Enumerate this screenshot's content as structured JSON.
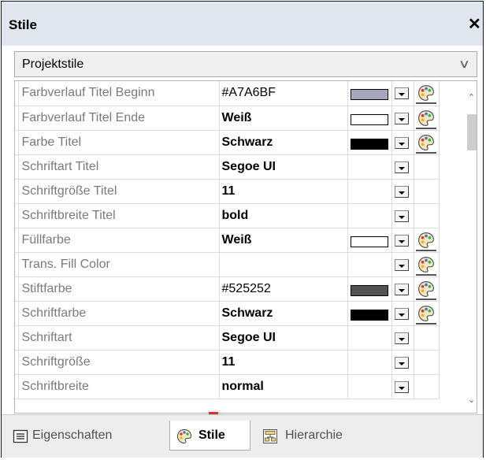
{
  "panel": {
    "title": "Stile",
    "close_glyph": "✕"
  },
  "selector": {
    "value": "Projektstile",
    "chevron": "﹀"
  },
  "properties": [
    {
      "name": "Farbverlauf Titel Beginn",
      "value": "#A7A6BF",
      "bold": false,
      "swatch": "#a7a6bf",
      "dropdown": true,
      "palette": true
    },
    {
      "name": "Farbverlauf Titel Ende",
      "value": "Weiß",
      "bold": true,
      "swatch": "#ffffff",
      "dropdown": true,
      "palette": true
    },
    {
      "name": "Farbe Titel",
      "value": "Schwarz",
      "bold": true,
      "swatch": "#000000",
      "dropdown": true,
      "palette": true
    },
    {
      "name": "Schriftart Titel",
      "value": "Segoe UI",
      "bold": true,
      "swatch": null,
      "dropdown": true,
      "palette": false
    },
    {
      "name": "Schriftgröße Titel",
      "value": "11",
      "bold": true,
      "swatch": null,
      "dropdown": true,
      "palette": false
    },
    {
      "name": "Schriftbreite Titel",
      "value": "bold",
      "bold": true,
      "swatch": null,
      "dropdown": true,
      "palette": false
    },
    {
      "name": "Füllfarbe",
      "value": "Weiß",
      "bold": true,
      "swatch": "#ffffff",
      "dropdown": true,
      "palette": true
    },
    {
      "name": "Trans. Fill Color",
      "value": "",
      "bold": false,
      "swatch": null,
      "dropdown": true,
      "palette": true
    },
    {
      "name": "Stiftfarbe",
      "value": "#525252",
      "bold": false,
      "swatch": "#525252",
      "dropdown": true,
      "palette": true
    },
    {
      "name": "Schriftfarbe",
      "value": "Schwarz",
      "bold": true,
      "swatch": "#000000",
      "dropdown": true,
      "palette": true
    },
    {
      "name": "Schriftart",
      "value": "Segoe UI",
      "bold": true,
      "swatch": null,
      "dropdown": true,
      "palette": false
    },
    {
      "name": "Schriftgröße",
      "value": "11",
      "bold": true,
      "swatch": null,
      "dropdown": true,
      "palette": false
    },
    {
      "name": "Schriftbreite",
      "value": "normal",
      "bold": true,
      "swatch": null,
      "dropdown": true,
      "palette": false
    }
  ],
  "scrollbar": {
    "up_glyph": "^",
    "down_glyph": "v"
  },
  "tabs": [
    {
      "id": "eigenschaften",
      "label": "Eigenschaften",
      "icon": "properties-list-icon",
      "active": false
    },
    {
      "id": "stile",
      "label": "Stile",
      "icon": "palette-icon",
      "active": true
    },
    {
      "id": "hierarchie",
      "label": "Hierarchie",
      "icon": "hierarchy-icon",
      "active": false
    }
  ],
  "colors": {
    "titlebar": "#dfe6ef",
    "tabbar": "#ecedee",
    "label_gray": "#7a7a7a"
  }
}
